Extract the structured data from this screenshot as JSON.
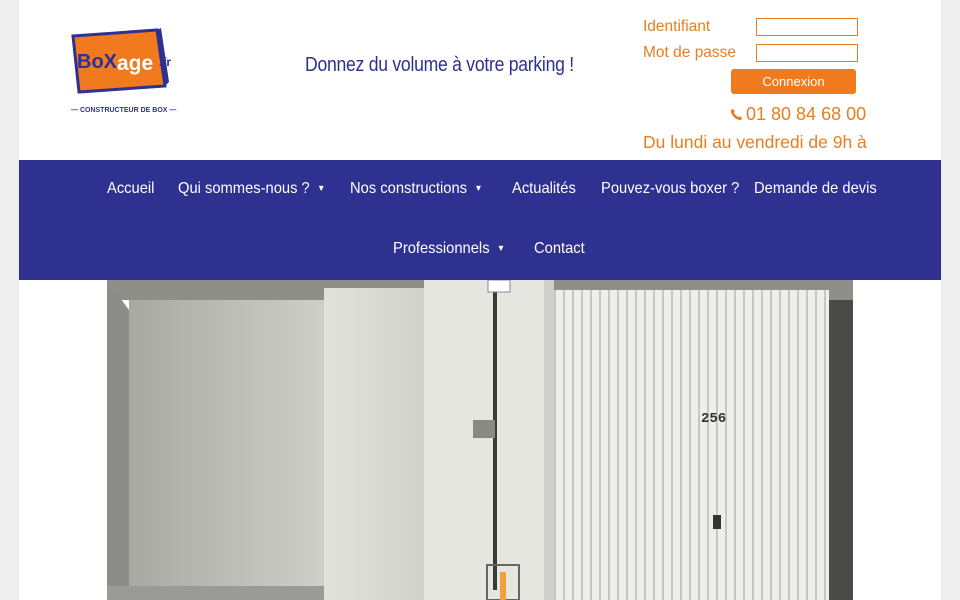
{
  "header": {
    "logo_text_box": "BoX",
    "logo_text_age": "age",
    "logo_text_fr": ".fr",
    "logo_subtitle": "— CONSTRUCTEUR DE BOX —",
    "tagline": "Donnez du volume à votre parking !"
  },
  "login": {
    "username_label": "Identifiant",
    "password_label": "Mot de passe",
    "username_value": "",
    "password_value": "",
    "submit_label": "Connexion"
  },
  "contact": {
    "phone": "01 80 84 68 00",
    "hours": "Du lundi au vendredi de 9h à"
  },
  "nav": {
    "items": [
      {
        "label": "Accueil"
      },
      {
        "label": "Qui sommes-nous ?"
      },
      {
        "label": "Nos constructions"
      },
      {
        "label": "Actualités"
      },
      {
        "label": "Pouvez-vous boxer ?"
      },
      {
        "label": "Demande de devis"
      },
      {
        "label": "Professionnels"
      },
      {
        "label": "Contact"
      }
    ],
    "caret": "▼"
  },
  "hero": {
    "door_number": "256"
  },
  "colors": {
    "brand_blue": "#2e3190",
    "brand_orange": "#e67e22",
    "button_orange": "#f07a1d"
  },
  "icons": [
    "phone-icon",
    "chevron-down-icon"
  ]
}
